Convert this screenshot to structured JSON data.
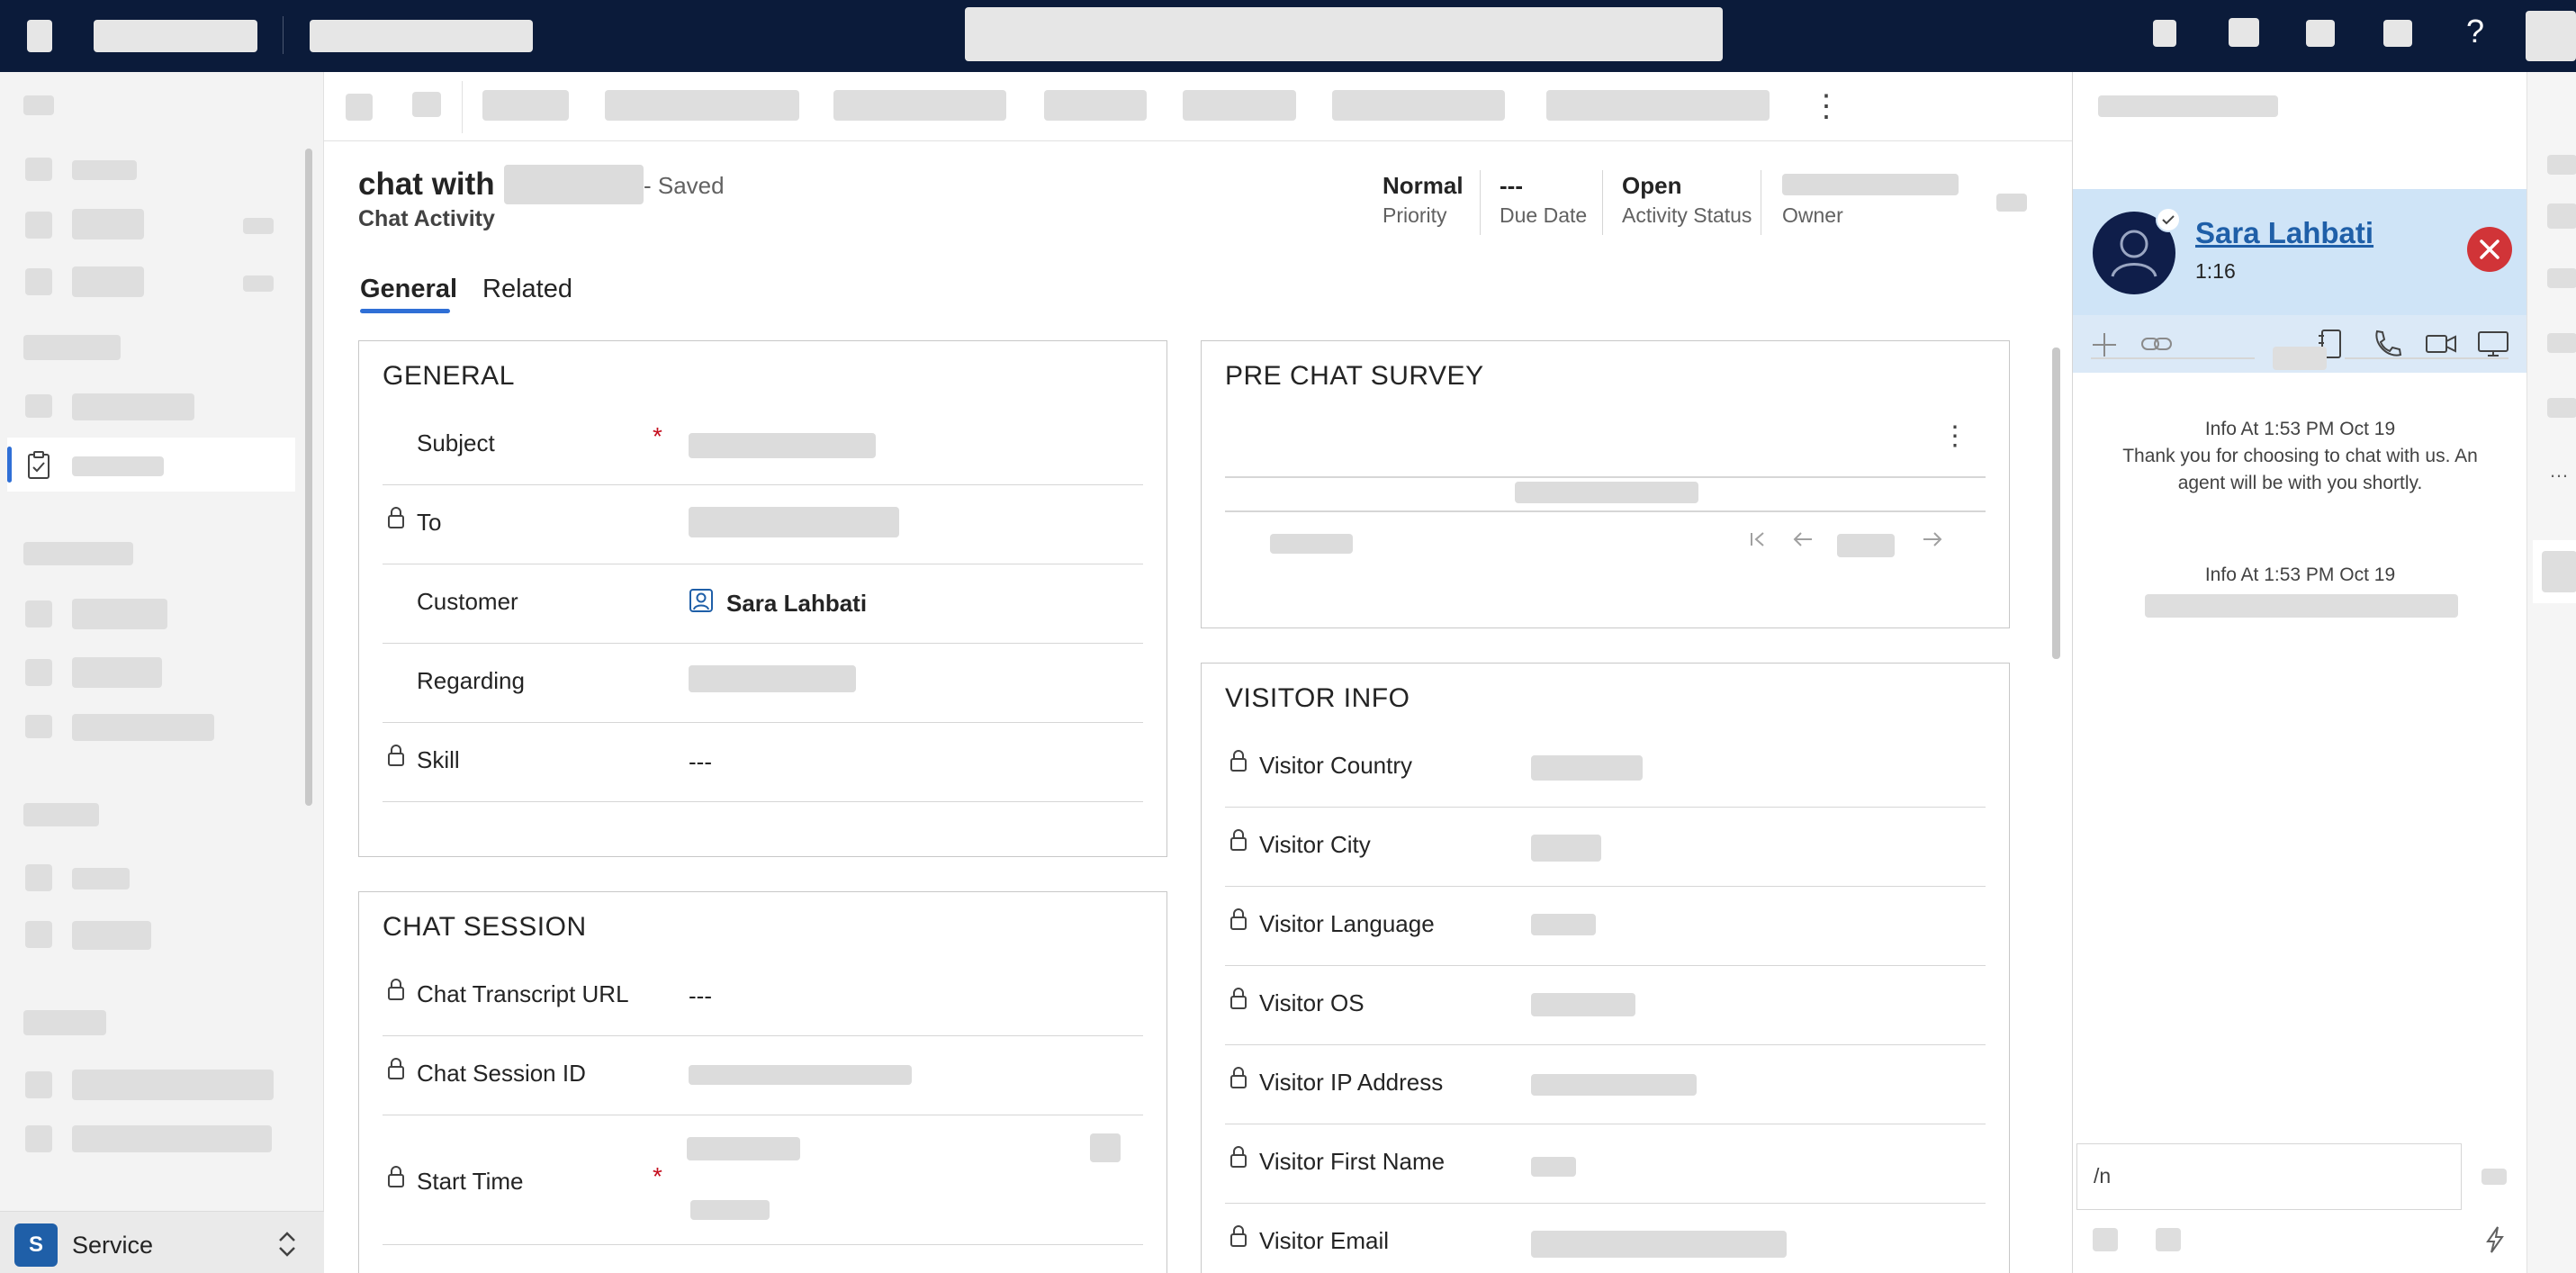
{
  "record": {
    "title": "chat with",
    "saved_status": "- Saved",
    "subtitle": "Chat Activity",
    "header_fields": [
      {
        "value": "Normal",
        "label": "Priority"
      },
      {
        "value": "---",
        "label": "Due Date"
      },
      {
        "value": "Open",
        "label": "Activity Status"
      },
      {
        "value": "",
        "label": "Owner"
      }
    ],
    "tabs": [
      "General",
      "Related"
    ]
  },
  "general_section": {
    "title": "GENERAL",
    "rows": [
      {
        "label": "Subject",
        "value": "",
        "required": true,
        "locked": false
      },
      {
        "label": "To",
        "value": "",
        "required": false,
        "locked": true
      },
      {
        "label": "Customer",
        "value": "Sara Lahbati",
        "required": false,
        "locked": false
      },
      {
        "label": "Regarding",
        "value": "",
        "required": false,
        "locked": false
      },
      {
        "label": "Skill",
        "value": "---",
        "required": false,
        "locked": true
      }
    ]
  },
  "chat_session_section": {
    "title": "CHAT SESSION",
    "rows": [
      {
        "label": "Chat Transcript URL",
        "value": "---"
      },
      {
        "label": "Chat Session ID",
        "value": ""
      },
      {
        "label": "Start Time",
        "value": ""
      }
    ]
  },
  "pre_chat_survey": {
    "title": "PRE CHAT SURVEY"
  },
  "visitor_info": {
    "title": "VISITOR INFO",
    "rows": [
      {
        "label": "Visitor Country"
      },
      {
        "label": "Visitor City"
      },
      {
        "label": "Visitor Language"
      },
      {
        "label": "Visitor OS"
      },
      {
        "label": "Visitor IP Address"
      },
      {
        "label": "Visitor First Name"
      },
      {
        "label": "Visitor Email"
      }
    ]
  },
  "chat_panel": {
    "contact_name": "Sara Lahbati",
    "elapsed": "1:16",
    "messages": [
      {
        "meta": "Info At 1:53 PM Oct 19",
        "text": "Thank you for choosing to chat with us. An agent will be with you shortly."
      },
      {
        "meta": "Info At 1:53 PM Oct 19",
        "text": ""
      }
    ],
    "input_value": "/n"
  },
  "app": {
    "badge": "S",
    "name": "Service"
  },
  "colors": {
    "top_bar": "#0b1b3a",
    "accent": "#2f6fd6",
    "link": "#1f5fa8",
    "chat_header": "#cfe4f7",
    "close_button": "#d13438",
    "required": "#c50f1f"
  },
  "icons": [
    "help-icon",
    "more-vertical-icon",
    "lock-icon",
    "contact-icon",
    "user-avatar-icon",
    "close-icon",
    "plus-icon",
    "link-icon",
    "notes-icon",
    "phone-icon",
    "video-icon",
    "screen-share-icon",
    "chevron-right-icon",
    "lightning-icon",
    "chevron-updown-icon",
    "clipboard-icon",
    "calendar-icon",
    "first-page-icon",
    "arrow-left-icon",
    "arrow-right-icon"
  ]
}
